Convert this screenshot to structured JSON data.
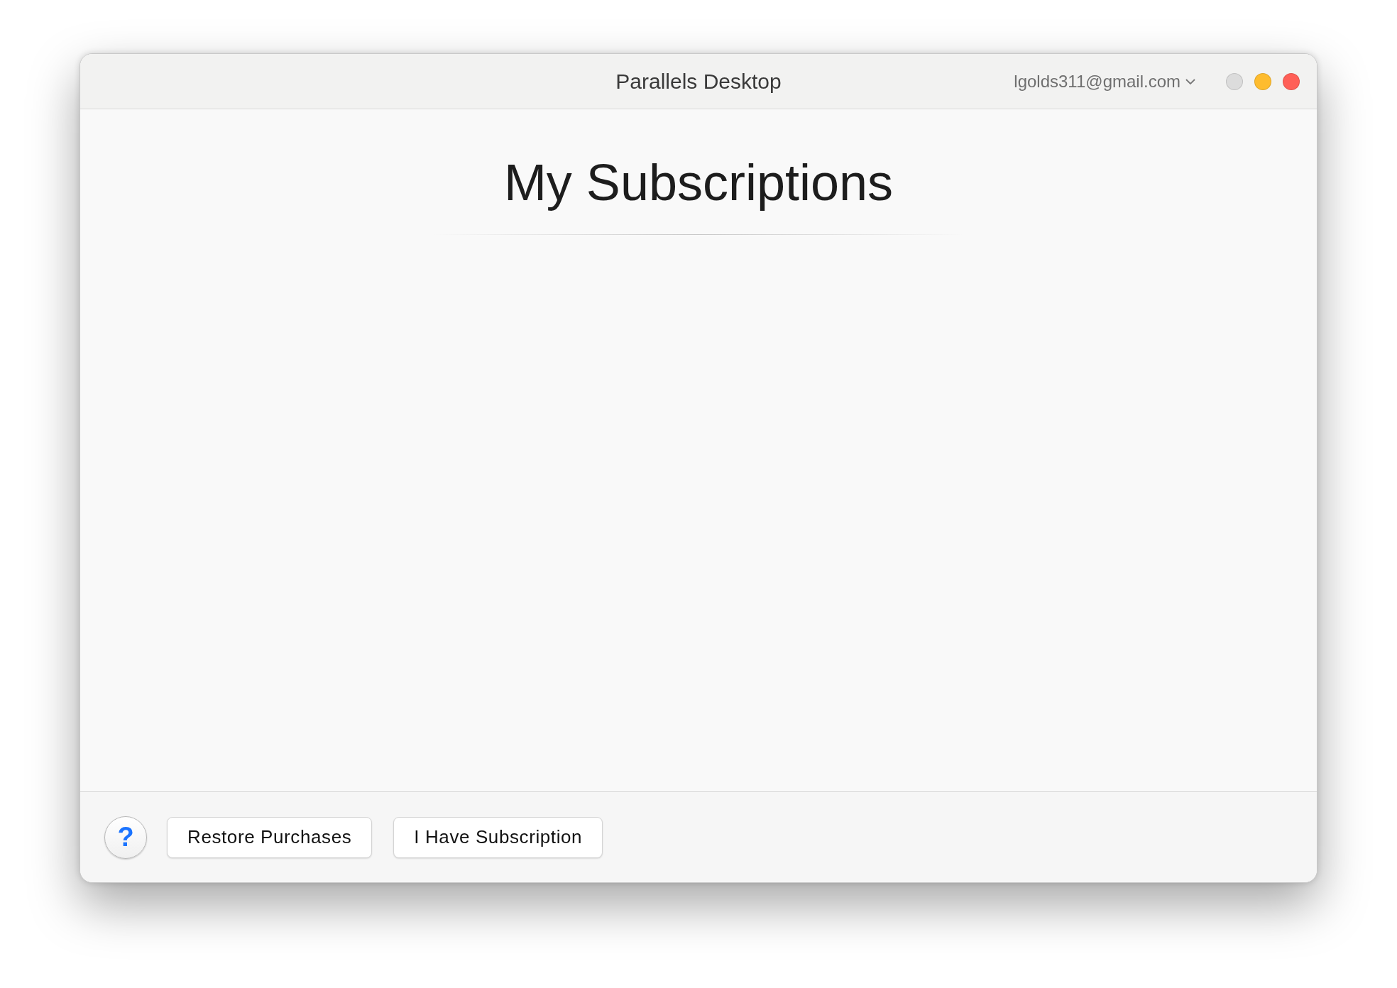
{
  "window": {
    "title": "Parallels Desktop",
    "account": "lgolds311@gmail.com",
    "controls": [
      {
        "color": "#dcdcdc"
      },
      {
        "color": "#febc2e"
      },
      {
        "color": "#ff5f57"
      }
    ]
  },
  "heading": "My Subscriptions",
  "footer": {
    "help": "?",
    "buttons": [
      "Restore Purchases",
      "I Have Subscription"
    ]
  }
}
